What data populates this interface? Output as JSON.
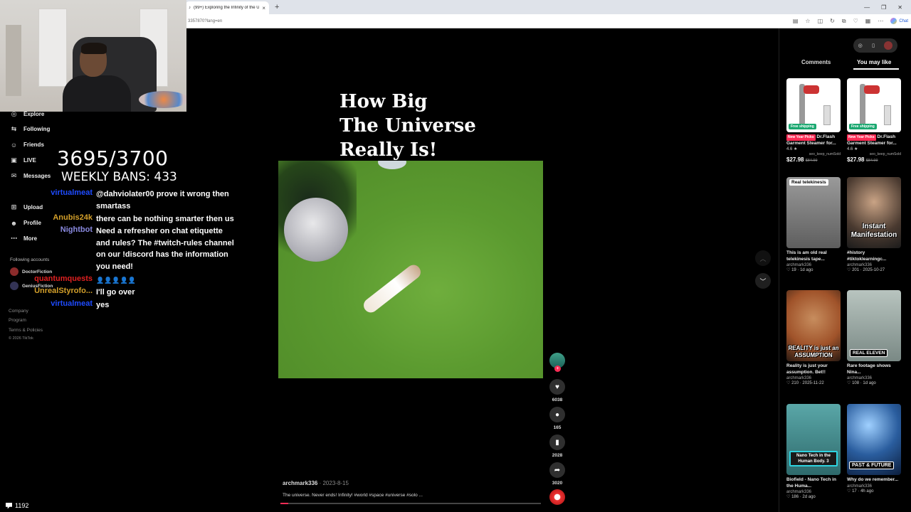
{
  "browser": {
    "tab_title": "(99+) Exploring the Infinity of the U",
    "tab_close": "×",
    "new_tab": "+",
    "url": "3357870?lang=en",
    "chat_label": "Chat"
  },
  "nav": {
    "items": [
      {
        "label": "Explore",
        "icon": "◎"
      },
      {
        "label": "Following",
        "icon": "⇆"
      },
      {
        "label": "Friends",
        "icon": "☺"
      },
      {
        "label": "LIVE",
        "icon": "▣"
      },
      {
        "label": "Messages",
        "icon": "✉"
      },
      {
        "label": "Upload",
        "icon": "⊞"
      },
      {
        "label": "Profile",
        "icon": "☻"
      },
      {
        "label": "More",
        "icon": "⋯"
      }
    ],
    "following_heading": "Following accounts",
    "accounts": [
      "DoctorFiction",
      "GeniusFiction"
    ],
    "footer": [
      "Company",
      "Program",
      "Terms & Policies",
      "© 2026 TikTok"
    ]
  },
  "stream": {
    "bans_count": "3695/3700",
    "bans_label": "WEEKLY BANS: 433",
    "viewers": "1192",
    "chat": [
      {
        "user": "virtualmeat",
        "user_color": "#1e4bff",
        "message": "@dahviolater00 prove it wrong then smartass"
      },
      {
        "user": "Anubis24k",
        "user_color": "#d4a02a",
        "message": "there can be nothing smarter then us"
      },
      {
        "user": "Nightbot",
        "user_color": "#8a8ae0",
        "message": "Need a refresher on chat etiquette and rules? The #twitch-rules channel on our !discord has the information you need!"
      },
      {
        "user": "quantumquests",
        "user_color": "#e02020",
        "message": "👤👤👤👤👤"
      },
      {
        "user": "UnrealStyrofo...",
        "user_color": "#d4a02a",
        "message": "I'll go over"
      },
      {
        "user": "virtualmeat",
        "user_color": "#1e4bff",
        "message": "yes"
      }
    ]
  },
  "video": {
    "title_lines": [
      "How Big",
      "The Universe",
      "Really Is!"
    ],
    "author": "archmark336",
    "date": " · 2023-8-15",
    "caption": "The universe. Never ends! Infinity! #world #space #universe #solo ...",
    "progress": 0.03,
    "likes": "6038",
    "comments": "165",
    "saves": "2028",
    "shares": "3020"
  },
  "right_panel": {
    "tabs": [
      "Comments",
      "You may like"
    ],
    "cards": [
      {
        "type": "product",
        "title": "Dr.Flash Garment Steamer for...",
        "badge": "New Year Picks",
        "rating": "4.6 ★",
        "sold": "seo_keep_numSold",
        "price": "$27.98",
        "old_price": "$84.99",
        "shipping": "Free shipping"
      },
      {
        "type": "product",
        "title": "Dr.Flash Garment Steamer for...",
        "badge": "New Year Picks",
        "rating": "4.6 ★",
        "sold": "seo_keep_numSold",
        "price": "$27.98",
        "old_price": "$84.99",
        "shipping": "Free shipping"
      },
      {
        "type": "video",
        "overlay": "Real telekinesis",
        "caption": "This is am old real telekinesis tape...",
        "author": "archmark336",
        "likes": "19",
        "date": "1d ago"
      },
      {
        "type": "video",
        "overlay": "Instant Manifestation",
        "caption": "#history #tiktoklearningc...",
        "author": "archmark336",
        "likes": "201",
        "date": "2025-10-27"
      },
      {
        "type": "video",
        "overlay": "REALITY is just an ASSUMPTION",
        "caption": "Reality is just your assumption. Bet!!",
        "author": "archmark336",
        "likes": "210",
        "date": "2025-11-22"
      },
      {
        "type": "video",
        "overlay": "REAL ELEVEN",
        "caption": "Rare footage shows Nina...",
        "author": "archmark336",
        "likes": "108",
        "date": "1d ago"
      },
      {
        "type": "video",
        "overlay": "Nano Tech in the Human Body. 3",
        "caption": "Biofield - Nano Tech in the Huma...",
        "author": "archmark336",
        "likes": "186",
        "date": "2d ago"
      },
      {
        "type": "video",
        "overlay": "PAST & FUTURE",
        "caption": "Why do we remember...",
        "author": "archmark336",
        "likes": "17",
        "date": "4h ago"
      }
    ]
  }
}
